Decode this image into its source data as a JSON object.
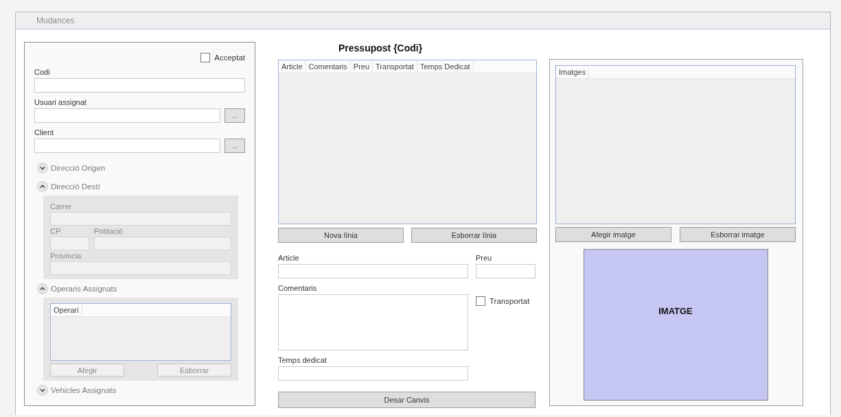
{
  "window": {
    "title": "Mudances"
  },
  "details": {
    "accepted": {
      "label": "Acceptat",
      "checked": false
    },
    "fields": [
      {
        "label": "Codi",
        "kind": "text"
      },
      {
        "label": "Usuari assignat",
        "kind": "lookup",
        "button": "..."
      },
      {
        "label": "Client",
        "kind": "lookup",
        "button": "..."
      }
    ],
    "sections": [
      {
        "title": "Direcció Origen",
        "expanded": false
      },
      {
        "title": "Direcció Destí",
        "expanded": true,
        "kind": "address",
        "disabled": true,
        "rows": [
          [
            {
              "label": "Carrer"
            }
          ],
          [
            {
              "label": "CP"
            },
            {
              "label": "Població"
            }
          ],
          [
            {
              "label": "Provincia"
            }
          ]
        ]
      },
      {
        "title": "Operaris Assignats",
        "expanded": true,
        "kind": "list",
        "disabled": true,
        "columns": [
          "Operari"
        ],
        "buttons": [
          "Afegir",
          "Esborrar"
        ]
      },
      {
        "title": "Vehicles Assignats",
        "expanded": false
      }
    ]
  },
  "budget": {
    "title": "Pressupost {Codi}",
    "columns": [
      "Article",
      "Comentaris",
      "Preu",
      "Transportat",
      "Temps Dedicat"
    ],
    "buttons": [
      "Nova línia",
      "Esborrar línia"
    ],
    "article": {
      "label": "Article"
    },
    "price": {
      "label": "Preu"
    },
    "comments": {
      "label": "Comentaris"
    },
    "transported": {
      "label": "Transportat",
      "checked": false
    },
    "time": {
      "label": "Temps dedicat"
    },
    "save_button": "Desar Canvis"
  },
  "images": {
    "columns": [
      "Imatges"
    ],
    "buttons": [
      "Afegir imatge",
      "Esborrar imatge"
    ],
    "preview": "IMATGE"
  }
}
